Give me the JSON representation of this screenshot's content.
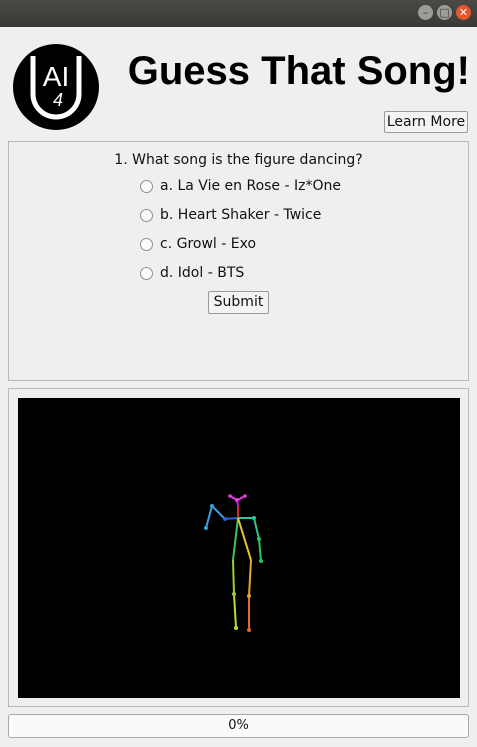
{
  "window": {
    "buttons": {
      "minimize": "–",
      "maximize": "□",
      "close": "✕"
    }
  },
  "header": {
    "logo_text_top": "AI",
    "logo_text_bottom": "4",
    "title": "Guess That Song!",
    "learn_more_label": "Learn More"
  },
  "quiz": {
    "question": "1. What song is the figure dancing?",
    "options": [
      {
        "label": "a. La Vie en Rose - Iz*One",
        "selected": false
      },
      {
        "label": "b. Heart Shaker - Twice",
        "selected": false
      },
      {
        "label": "c. Growl - Exo",
        "selected": false
      },
      {
        "label": "d. Idol - BTS",
        "selected": false
      }
    ],
    "submit_label": "Submit"
  },
  "video": {
    "background": "#000000",
    "skeleton_colors": {
      "head": "#e53be0",
      "torso_left": "#2e7cd6",
      "torso_right": "#e8c62e",
      "arm_left": "#3aa0e0",
      "arm_right": "#2ec4a0",
      "leg_left": "#9acd32",
      "leg_right": "#e06b2e"
    }
  },
  "progress": {
    "label": "0%",
    "value": 0
  }
}
